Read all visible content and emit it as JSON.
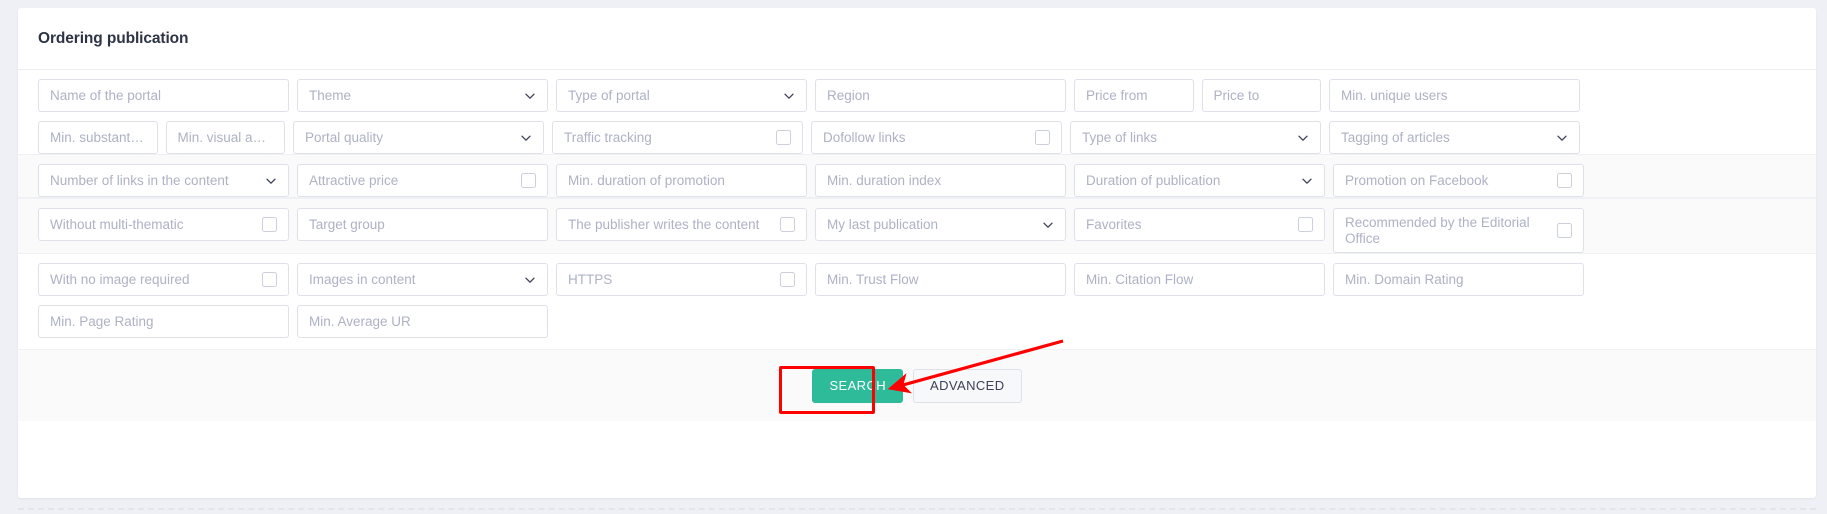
{
  "header": {
    "title": "Ordering publication"
  },
  "rows": [
    {
      "shaded": false,
      "fields": [
        {
          "name": "name-of-the-portal",
          "placeholder": "Name of the portal",
          "type": "text",
          "col": "c1"
        },
        {
          "name": "theme",
          "placeholder": "Theme",
          "type": "select",
          "col": "c2"
        },
        {
          "name": "type-of-portal",
          "placeholder": "Type of portal",
          "type": "select",
          "col": "c3"
        },
        {
          "name": "region",
          "placeholder": "Region",
          "type": "text",
          "col": "c4"
        },
        {
          "name": "price-from",
          "placeholder": "Price from",
          "type": "text",
          "col": "c-half"
        },
        {
          "name": "price-to",
          "placeholder": "Price to",
          "type": "text",
          "col": "c-half"
        },
        {
          "name": "min-unique-users",
          "placeholder": "Min. unique users",
          "type": "text",
          "col": "c6"
        }
      ]
    },
    {
      "shaded": false,
      "fields": [
        {
          "name": "min-substantive",
          "placeholder": "Min. substant…",
          "type": "text",
          "col": "c-half"
        },
        {
          "name": "min-visual-attractiveness",
          "placeholder": "Min. visual a…",
          "type": "text",
          "col": "c-half"
        },
        {
          "name": "portal-quality",
          "placeholder": "Portal quality",
          "type": "select",
          "col": "c2"
        },
        {
          "name": "traffic-tracking",
          "placeholder": "Traffic tracking",
          "type": "checkbox",
          "col": "c3"
        },
        {
          "name": "dofollow-links",
          "placeholder": "Dofollow links",
          "type": "checkbox",
          "col": "c4"
        },
        {
          "name": "type-of-links",
          "placeholder": "Type of links",
          "type": "select",
          "col": "c5"
        },
        {
          "name": "tagging-of-articles",
          "placeholder": "Tagging of articles",
          "type": "select",
          "col": "c6"
        }
      ]
    },
    {
      "shaded": true,
      "fields": [
        {
          "name": "number-of-links-in-the-content",
          "placeholder": "Number of links in the content",
          "type": "select",
          "col": "c1"
        },
        {
          "name": "attractive-price",
          "placeholder": "Attractive price",
          "type": "checkbox",
          "col": "c2"
        },
        {
          "name": "min-duration-of-promotion",
          "placeholder": "Min. duration of promotion",
          "type": "text",
          "col": "c3"
        },
        {
          "name": "min-duration-index",
          "placeholder": "Min. duration index",
          "type": "text",
          "col": "c4"
        },
        {
          "name": "duration-of-publication",
          "placeholder": "Duration of publication",
          "type": "select",
          "col": "c5"
        },
        {
          "name": "promotion-on-facebook",
          "placeholder": "Promotion on Facebook",
          "type": "checkbox",
          "col": "c6"
        }
      ]
    },
    {
      "shaded": true,
      "fields": [
        {
          "name": "without-multi-thematic",
          "placeholder": "Without multi-thematic",
          "type": "checkbox",
          "col": "c1"
        },
        {
          "name": "target-group",
          "placeholder": "Target group",
          "type": "text",
          "col": "c2"
        },
        {
          "name": "the-publisher-writes-the-content",
          "placeholder": "The publisher writes the content",
          "type": "checkbox",
          "col": "c3"
        },
        {
          "name": "my-last-publication",
          "placeholder": "My last publication",
          "type": "select",
          "col": "c4"
        },
        {
          "name": "favorites",
          "placeholder": "Favorites",
          "type": "checkbox",
          "col": "c5"
        },
        {
          "name": "recommended-by-the-editorial-office",
          "placeholder": "Recommended by the Editorial Office",
          "type": "checkbox-wrap",
          "col": "c6"
        }
      ]
    },
    {
      "shaded": false,
      "fields": [
        {
          "name": "with-no-image-required",
          "placeholder": "With no image required",
          "type": "checkbox",
          "col": "c1"
        },
        {
          "name": "images-in-content",
          "placeholder": "Images in content",
          "type": "select",
          "col": "c2"
        },
        {
          "name": "https",
          "placeholder": "HTTPS",
          "type": "checkbox",
          "col": "c3"
        },
        {
          "name": "min-trust-flow",
          "placeholder": "Min. Trust Flow",
          "type": "text",
          "col": "c4"
        },
        {
          "name": "min-citation-flow",
          "placeholder": "Min. Citation Flow",
          "type": "text",
          "col": "c5"
        },
        {
          "name": "min-domain-rating",
          "placeholder": "Min. Domain Rating",
          "type": "text",
          "col": "c6"
        }
      ]
    },
    {
      "shaded": false,
      "fields": [
        {
          "name": "min-page-rating",
          "placeholder": "Min. Page Rating",
          "type": "text",
          "col": "c1"
        },
        {
          "name": "min-average-ur",
          "placeholder": "Min. Average UR",
          "type": "text",
          "col": "c2"
        }
      ]
    }
  ],
  "actions": {
    "search_label": "SEARCH",
    "advanced_label": "ADVANCED"
  },
  "annotation": {
    "highlight_color": "#ff0000",
    "target": "ADVANCED"
  },
  "colors": {
    "accent_teal": "#2dbb9a",
    "annotation_red": "#ff0000",
    "placeholder_gray": "#adb2c4",
    "border_gray": "#dfe1ea",
    "page_bg": "#eef0f5",
    "band_shade": "#fafafb"
  }
}
